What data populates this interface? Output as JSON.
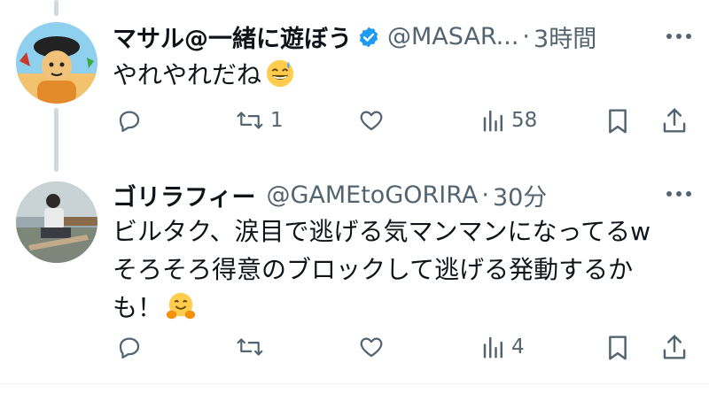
{
  "tweets": [
    {
      "name": "マサル@一緒に遊ぼう",
      "handle": "@MASAR...",
      "separator": "·",
      "time": "3時間",
      "lines": [
        "やれやれだね"
      ],
      "emoji": "sweat-smile",
      "replies": "",
      "retweets": "1",
      "likes": "",
      "views": "58",
      "verified": true
    },
    {
      "name": "ゴリラフィー",
      "handle": "@GAMEtoGORIRA",
      "separator": "·",
      "time": "30分",
      "lines": [
        "ビルタク、涙目で逃げる気マンマンになってるw",
        "そろそろ得意のブロックして逃げる発動するか",
        "も！"
      ],
      "emoji": "hugging-face",
      "replies": "",
      "retweets": "",
      "likes": "",
      "views": "4",
      "verified": false
    }
  ],
  "colors": {
    "text": "#0f1419",
    "muted": "#536471",
    "verified": "#1d9bf0",
    "thread": "#cfd9de"
  }
}
